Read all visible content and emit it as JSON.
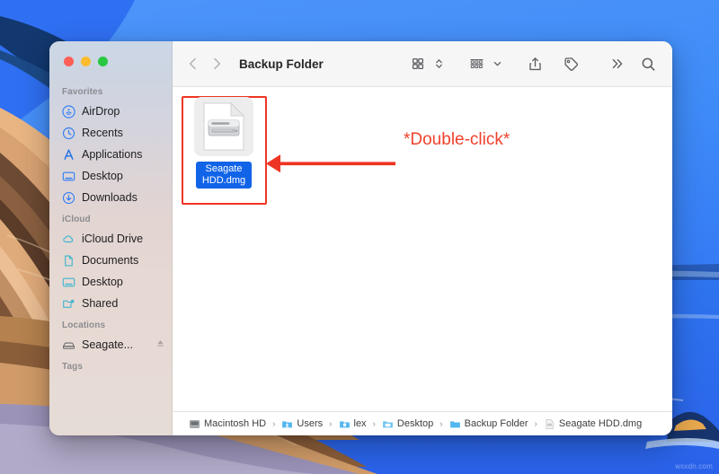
{
  "window": {
    "title": "Backup Folder",
    "traffic_lights": [
      "close",
      "minimize",
      "maximize"
    ]
  },
  "toolbar": {
    "back_icon": "chevron-left-icon",
    "forward_icon": "chevron-right-icon",
    "view_icon": "icon-view-grid-icon",
    "view_chevron_icon": "chevron-up-down-icon",
    "group_icon": "group-by-icon",
    "group_chevron_icon": "chevron-down-icon",
    "share_icon": "share-icon",
    "tag_icon": "tag-icon",
    "more_icon": "double-chevron-right-icon",
    "search_icon": "search-icon"
  },
  "sidebar": {
    "sections": [
      {
        "label": "Favorites",
        "items": [
          {
            "label": "AirDrop",
            "icon": "airdrop-icon"
          },
          {
            "label": "Recents",
            "icon": "clock-icon"
          },
          {
            "label": "Applications",
            "icon": "app-store-icon"
          },
          {
            "label": "Desktop",
            "icon": "desktop-icon"
          },
          {
            "label": "Downloads",
            "icon": "download-icon"
          }
        ]
      },
      {
        "label": "iCloud",
        "items": [
          {
            "label": "iCloud Drive",
            "icon": "cloud-icon"
          },
          {
            "label": "Documents",
            "icon": "document-icon"
          },
          {
            "label": "Desktop",
            "icon": "desktop-icon"
          },
          {
            "label": "Shared",
            "icon": "shared-folder-icon"
          }
        ]
      },
      {
        "label": "Locations",
        "items": [
          {
            "label": "Seagate...",
            "icon": "external-drive-icon",
            "eject": "eject-icon"
          }
        ]
      },
      {
        "label": "Tags",
        "items": []
      }
    ]
  },
  "files": [
    {
      "name_line1": "Seagate",
      "name_line2": "HDD.dmg",
      "icon": "disk-image-dmg-icon",
      "selected": true
    }
  ],
  "annotation": {
    "text": "*Double-click*",
    "color": "#f0412c",
    "arrow_icon": "left-arrow-icon"
  },
  "path_bar": {
    "crumbs": [
      {
        "label": "Macintosh HD",
        "icon": "hard-drive-icon"
      },
      {
        "label": "Users",
        "icon": "users-folder-icon"
      },
      {
        "label": "lex",
        "icon": "home-folder-icon"
      },
      {
        "label": "Desktop",
        "icon": "desktop-folder-icon"
      },
      {
        "label": "Backup Folder",
        "icon": "folder-icon"
      },
      {
        "label": "Seagate HDD.dmg",
        "icon": "dmg-file-icon"
      }
    ],
    "separator": "›"
  },
  "watermark": {
    "text": "wsxdn.com"
  },
  "colors": {
    "accent_selection": "#1164e8",
    "annotation_red": "#ee3524",
    "desktop_blue": "#3b86f7"
  }
}
